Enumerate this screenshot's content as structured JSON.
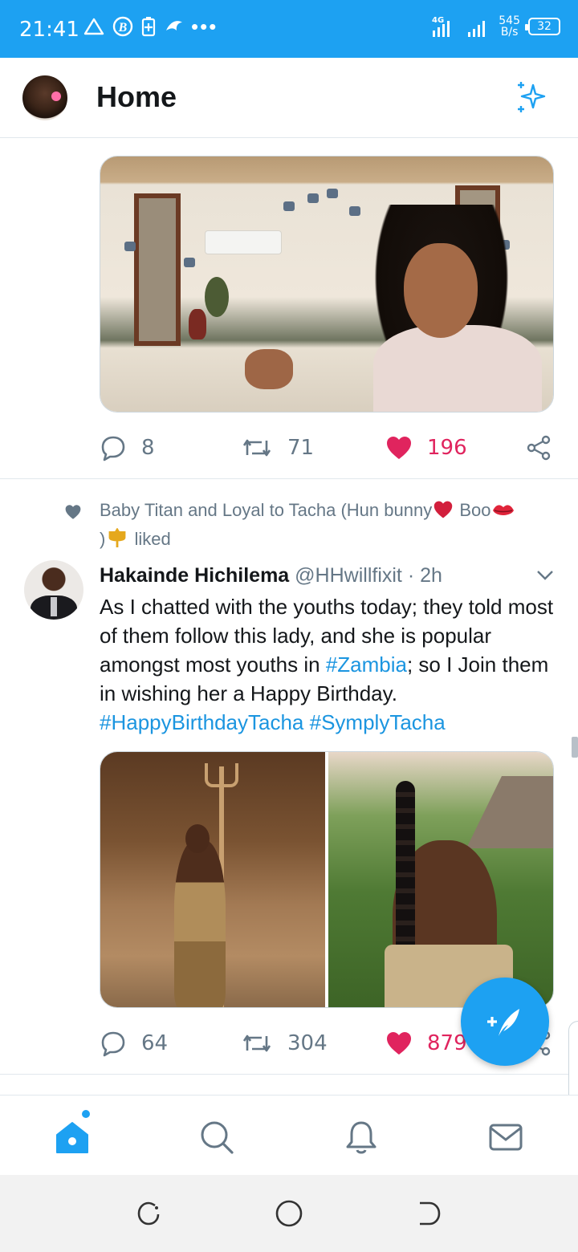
{
  "status_bar": {
    "time": "21:41",
    "network_label": "4G",
    "net_speed_value": "545",
    "net_speed_unit": "B/s",
    "battery": "32"
  },
  "header": {
    "title": "Home",
    "sparkle_icon": "sparkle-icon"
  },
  "tweets": [
    {
      "reply_count": "8",
      "retweet_count": "71",
      "like_count": "196",
      "liked": true
    },
    {
      "social_context_line1": "Baby Titan and Loyal to Tacha (Hun bunny",
      "social_context_boo": "Boo",
      "social_context_line2_open": ")",
      "social_context_liked": "liked",
      "author_name": "Hakainde Hichilema",
      "author_handle": "@HHwillfixit",
      "separator": "·",
      "time": "2h",
      "text_part1": "As I chatted with the youths today; they told most of them follow this lady, and she is popular amongst most youths in ",
      "hashtag_zambia": "#Zambia",
      "text_part2": "; so I Join them in wishing her a Happy Birthday.",
      "hashtag_birthday": "#HappyBirthdayTacha",
      "hashtag_symply": "#SymplyTacha",
      "reply_count": "64",
      "retweet_count": "304",
      "like_count": "879",
      "liked": true
    }
  ],
  "bottom_nav": [
    "home-icon",
    "search-icon",
    "bell-icon",
    "mail-icon"
  ],
  "colors": {
    "brand": "#1da1f2",
    "like": "#e0245e",
    "muted": "#657786",
    "hashtag": "#1b95e0"
  }
}
